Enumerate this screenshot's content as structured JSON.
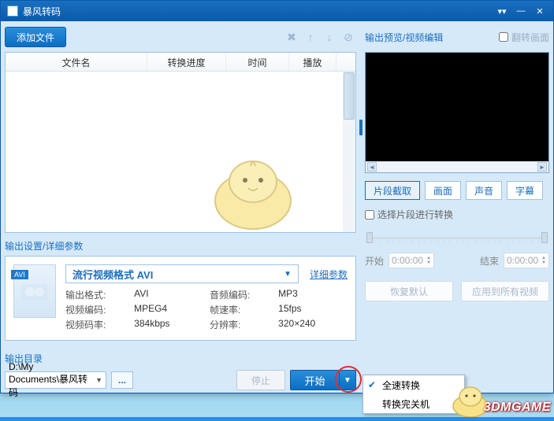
{
  "title": "暴风转码",
  "toolbar": {
    "add_label": "添加文件"
  },
  "list": {
    "col_name": "文件名",
    "col_progress": "转换进度",
    "col_time": "时间",
    "col_play": "播放"
  },
  "settings": {
    "section_label": "输出设置/详细参数",
    "format_badge": "AVI",
    "format_select": "流行视频格式 AVI",
    "detail_link": "详细参数",
    "k_out": "输出格式:",
    "v_out": "AVI",
    "k_ac": "音频编码:",
    "v_ac": "MP3",
    "k_vc": "视频编码:",
    "v_vc": "MPEG4",
    "k_fps": "帧速率:",
    "v_fps": "15fps",
    "k_vbr": "视频码率:",
    "v_vbr": "384kbps",
    "k_res": "分辨率:",
    "v_res": "320×240"
  },
  "output": {
    "label": "输出目录",
    "path": "D:\\My Documents\\暴风转码",
    "browse": "...",
    "stop": "停止",
    "start": "开始"
  },
  "preview": {
    "label": "输出预览/视频编辑",
    "flip": "翻转画面"
  },
  "tabs": {
    "clip": "片段截取",
    "pic": "画面",
    "audio": "声音",
    "sub": "字幕"
  },
  "segment": {
    "chk": "选择片段进行转换",
    "start_lbl": "开始",
    "start_val": "0:00:00",
    "end_lbl": "结束",
    "end_val": "0:00:00"
  },
  "buttons": {
    "reset": "恢复默认",
    "apply": "应用到所有视频"
  },
  "menu": {
    "item1": "全速转换",
    "item2": "转换完关机"
  },
  "watermark": "3DMGAME"
}
